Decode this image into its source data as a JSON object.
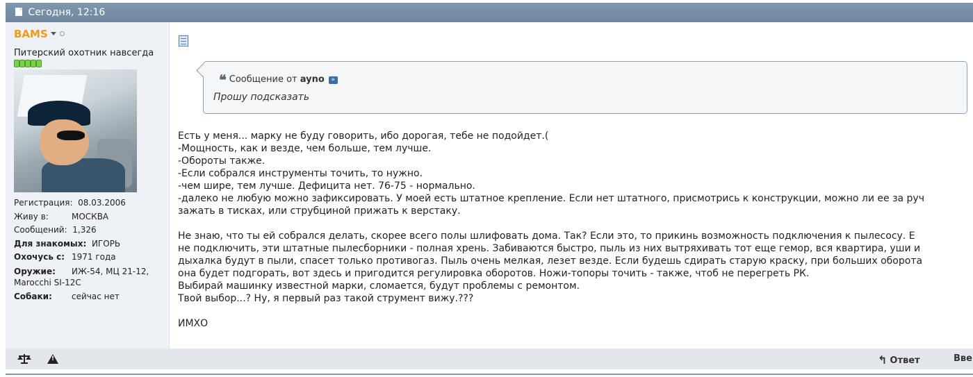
{
  "header": {
    "date": "Сегодня, 12:16"
  },
  "user": {
    "name": "BAMS",
    "title": "Питерский охотник навсегда",
    "fields": [
      {
        "key": "Регистрация:",
        "value": "08.03.2006",
        "bold": false
      },
      {
        "key": "Живу в:",
        "value": "МОСКВА",
        "bold": false
      },
      {
        "key": "Сообщений:",
        "value": "1,326",
        "bold": false
      },
      {
        "key": "Для знакомых:",
        "value": "ИГОРЬ",
        "bold": true
      },
      {
        "key": "Охочусь с:",
        "value": "1971 года",
        "bold": true
      },
      {
        "key": "Оружие:",
        "value": "ИЖ-54, МЦ 21-12, Marocchi SI-12C",
        "bold": true
      },
      {
        "key": "Собаки:",
        "value": "сейчас нет",
        "bold": true
      }
    ],
    "reputation_pips": 5
  },
  "quote": {
    "prefix": "Сообщение от",
    "author": "ayno",
    "text": "Прошу подсказать"
  },
  "message": {
    "lines": [
      "Есть у меня... марку не буду говорить, ибо дорогая, тебе не подойдет.(",
      "-Мощность, как и везде, чем больше, тем лучше.",
      "-Обороты также.",
      "-Если собрался инструменты точить, то нужно.",
      "-чем шире, тем лучше. Дефицита нет. 76-75 - нормально.",
      "-далеко не любую можно зафиксировать. У моей есть штатное крепление. Если нет штатного, присмотрись к конструкции, можно ли ее за руч",
      "зажать в тисках, или струбциной прижать к верстаку.",
      "",
      "Не знаю, что ты ей собрался делать, скорее всего полы шлифовать дома. Так? Если это, то прикинь возможность подключения к пылесосу. Е",
      "не подключить, эти штатные пылесборники - полная хрень. Забиваются быстро, пыль из них вытряхивать тот еще гемор, вся квартира, уши и",
      "дыхалка будут в пыли, спасет только противогаз. Пыль очень мелкая, лезет везде. Если будешь сдирать старую краску, при больших оборота",
      "она будет подгорать, вот здесь и пригодится регулировка оборотов. Ножи-топоры точить - также, чтоб не перегреть РК.",
      "Выбирай машинку известной марки, сломается, будут проблемы с ремонтом.",
      "Твой выбор...? Ну, я первый раз такой струмент вижу.???",
      "",
      "ИМХО"
    ]
  },
  "footer": {
    "reply_label": "Ответ",
    "top_label": "Вверх"
  },
  "colors": {
    "username": "#f09a1a",
    "header_bg": "#7f97ad",
    "sidebar_bg": "#eef1f6"
  }
}
